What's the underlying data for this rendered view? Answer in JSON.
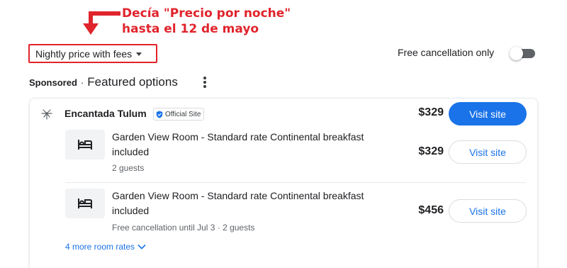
{
  "annotation": {
    "text": "Decía \"Precio por noche\"\nhasta el 12 de mayo",
    "color": "#e0242c"
  },
  "filters": {
    "price_dropdown_label": "Nightly price with fees",
    "free_cancellation_label": "Free cancellation only",
    "free_cancellation_enabled": false
  },
  "section": {
    "sponsored": "Sponsored",
    "separator": "·",
    "title": "Featured options"
  },
  "hotel": {
    "name": "Encantada Tulum",
    "official_badge": "Official Site",
    "price": "$329",
    "visit_label": "Visit site"
  },
  "rooms": [
    {
      "title": "Garden View Room - Standard rate Continental breakfast included",
      "subtitle": "2 guests",
      "price": "$329",
      "visit_label": "Visit site",
      "icon": "bed-icon"
    },
    {
      "title": "Garden View Room - Standard rate Continental breakfast included",
      "subtitle": "Free cancellation until Jul 3 · 2 guests",
      "price": "$456",
      "visit_label": "Visit site",
      "icon": "bed-icon"
    }
  ],
  "more_rates": {
    "label": "4 more room rates",
    "icon": "chevron-down-icon"
  },
  "colors": {
    "accent": "#1a73e8",
    "highlight": "#e0242c"
  }
}
